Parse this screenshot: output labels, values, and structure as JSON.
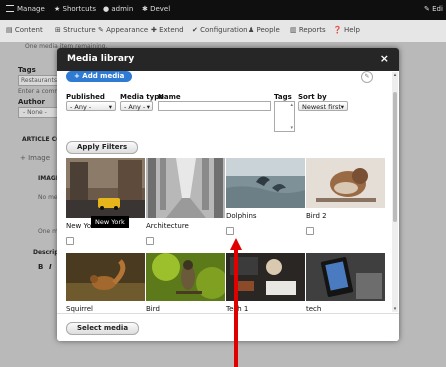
{
  "toolbar": {
    "items": [
      "Manage",
      "Shortcuts",
      "admin",
      "Devel"
    ],
    "edit_label": "Edi"
  },
  "tray": {
    "items": [
      "Content",
      "Structure",
      "Appearance",
      "Extend",
      "Configuration",
      "People",
      "Reports",
      "Help"
    ]
  },
  "background": {
    "hint_text": "One media item remaining.",
    "tags_label": "Tags",
    "tags_value": "Restaurants",
    "tags_hint": "Enter a comma",
    "author_label": "Author",
    "author_value": "- None -",
    "article_label": "ARTICLE CO",
    "image_label": "Image",
    "imag_label": "IMAGE",
    "nomedia": "No me",
    "onemedia": "One me",
    "description_label": "Descripti",
    "bold": "B",
    "italic": "I"
  },
  "modal": {
    "title": "Media library",
    "close": "×",
    "add_media": "+ Add media",
    "filters": {
      "published_label": "Published",
      "published_value": "- Any -",
      "media_type_label": "Media type",
      "media_type_value": "- Any -",
      "name_label": "Name",
      "name_value": "",
      "tags_label": "Tags",
      "sort_label": "Sort by",
      "sort_value": "Newest first"
    },
    "apply_filters": "Apply Filters",
    "select_media": "Select media",
    "tooltip": "New York",
    "items": [
      {
        "name": "New York",
        "image": "city-street"
      },
      {
        "name": "Architecture",
        "image": "colonnade"
      },
      {
        "name": "Dolphins",
        "image": "dolphins-sea"
      },
      {
        "name": "Bird 2",
        "image": "sparrow"
      },
      {
        "name": "Squirrel",
        "image": "squirrel"
      },
      {
        "name": "Bird",
        "image": "bird-on-branch"
      },
      {
        "name": "Tech 1",
        "image": "desk-tech"
      },
      {
        "name": "tech",
        "image": "tablet"
      }
    ]
  },
  "colors": {
    "accent": "#2f7bd3",
    "modal_header": "#262626",
    "annotation_arrow": "#e00000"
  }
}
